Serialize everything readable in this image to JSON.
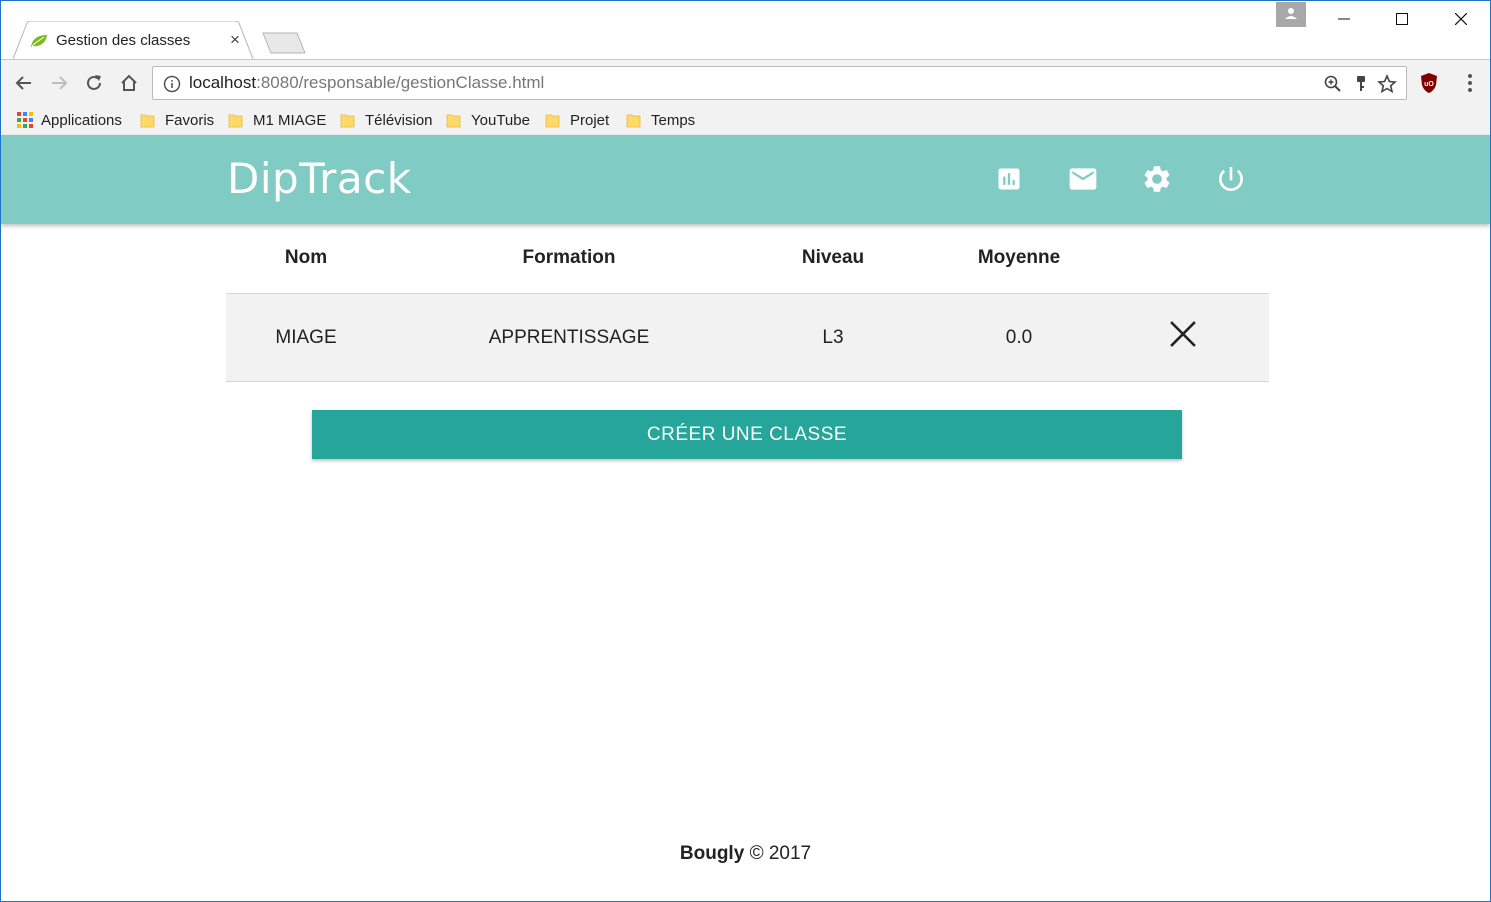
{
  "browser": {
    "tab": {
      "title": "Gestion des classes",
      "close": "×"
    },
    "url": {
      "host": "localhost",
      "path": ":8080/responsable/gestionClasse.html"
    },
    "bookmarks": [
      {
        "label": "Applications",
        "icon": "apps-grid-icon"
      },
      {
        "label": "Favoris",
        "icon": "folder-icon"
      },
      {
        "label": "M1 MIAGE",
        "icon": "folder-icon"
      },
      {
        "label": "Télévision",
        "icon": "folder-icon"
      },
      {
        "label": "YouTube",
        "icon": "folder-icon"
      },
      {
        "label": "Projet",
        "icon": "folder-icon"
      },
      {
        "label": "Temps",
        "icon": "folder-icon"
      }
    ]
  },
  "app": {
    "brand": "DipTrack",
    "header_color": "#80cbc4",
    "accent_color": "#26a69a",
    "header_icons": [
      "chart-icon",
      "mail-icon",
      "settings-icon",
      "power-icon"
    ]
  },
  "table": {
    "columns": [
      "Nom",
      "Formation",
      "Niveau",
      "Moyenne"
    ],
    "rows": [
      {
        "nom": "MIAGE",
        "formation": "APPRENTISSAGE",
        "niveau": "L3",
        "moyenne": "0.0"
      }
    ]
  },
  "create_button": "CRÉER UNE CLASSE",
  "footer": {
    "author": "Bougly",
    "copyright": "© 2017"
  }
}
